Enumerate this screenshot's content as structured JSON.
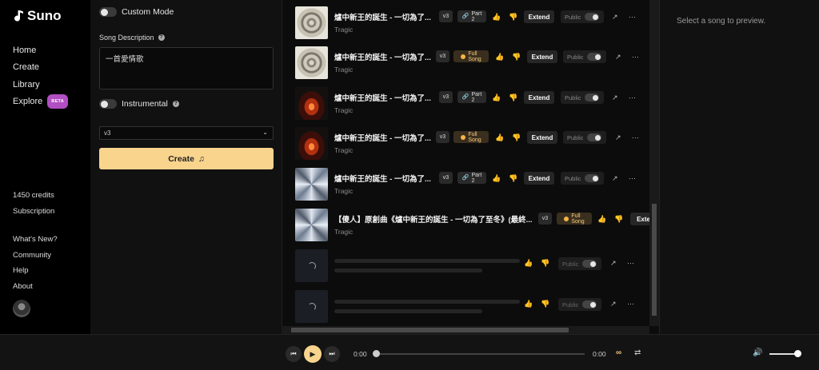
{
  "sidebar": {
    "logo": "Suno",
    "nav": [
      {
        "label": "Home"
      },
      {
        "label": "Create"
      },
      {
        "label": "Library"
      },
      {
        "label": "Explore",
        "badge": "BETA"
      }
    ],
    "credits": "1450 credits",
    "subscription": "Subscription",
    "links": [
      "What's New?",
      "Community",
      "Help",
      "About"
    ]
  },
  "create": {
    "custom_mode_label": "Custom Mode",
    "song_description_label": "Song Description",
    "song_description_value": "一首愛情歌",
    "instrumental_label": "Instrumental",
    "model_select": "v3",
    "create_label": "Create"
  },
  "songs": [
    {
      "title": "爐中新王的誕生 - 一切為了...",
      "style": "Tragic",
      "version": "v3",
      "tag_line1": "Part",
      "tag_line2": "2",
      "tag_type": "part",
      "extend": "Extend",
      "public": "Public"
    },
    {
      "title": "爐中新王的誕生 - 一切為了...",
      "style": "Tragic",
      "version": "v3",
      "tag_line1": "Full",
      "tag_line2": "Song",
      "tag_type": "full",
      "extend": "Extend",
      "public": "Public"
    },
    {
      "title": "爐中新王的誕生 - 一切為了...",
      "style": "Tragic",
      "version": "v3",
      "tag_line1": "Part",
      "tag_line2": "2",
      "tag_type": "part",
      "extend": "Extend",
      "public": "Public"
    },
    {
      "title": "爐中新王的誕生 - 一切為了...",
      "style": "Tragic",
      "version": "v3",
      "tag_line1": "Full",
      "tag_line2": "Song",
      "tag_type": "full",
      "extend": "Extend",
      "public": "Public"
    },
    {
      "title": "爐中新王的誕生 - 一切為了...",
      "style": "Tragic",
      "version": "v3",
      "tag_line1": "Part",
      "tag_line2": "2",
      "tag_type": "part",
      "extend": "Extend",
      "public": "Public"
    },
    {
      "title": "【傻人】原創曲《爐中新王的誕生 - 一切為了至冬》(最終...",
      "style": "Tragic",
      "version": "v3",
      "tag_line1": "Full",
      "tag_line2": "Song",
      "tag_type": "full",
      "extend": "Exten"
    }
  ],
  "loading_public": "Public",
  "preview": {
    "placeholder": "Select a song to preview."
  },
  "player": {
    "time_current": "0:00",
    "time_total": "0:00",
    "progress": 0,
    "volume": 0.9
  },
  "colors": {
    "accent": "#f9d48d",
    "badge_beta": "#b24fc2",
    "full_song_chip": "#3a2f1f"
  }
}
